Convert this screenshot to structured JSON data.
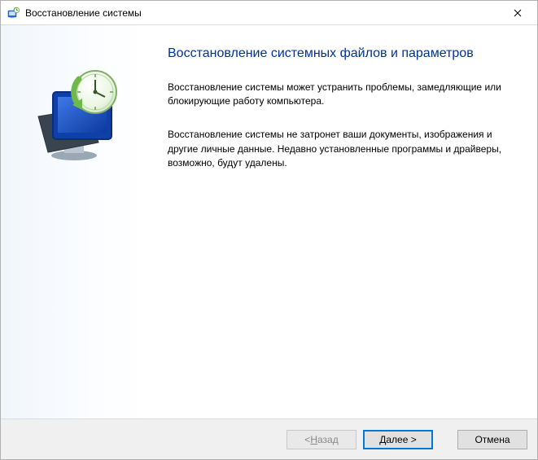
{
  "window": {
    "title": "Восстановление системы"
  },
  "content": {
    "heading": "Восстановление системных файлов и параметров",
    "para1": "Восстановление системы может устранить проблемы, замедляющие или блокирующие работу компьютера.",
    "para2": "Восстановление системы не затронет ваши документы, изображения и другие личные данные. Недавно установленные программы и драйверы, возможно, будут удалены."
  },
  "footer": {
    "back_prefix": "< ",
    "back_mn": "Н",
    "back_suffix": "азад",
    "next_mn": "Д",
    "next_suffix": "алее >",
    "cancel": "Отмена"
  },
  "icons": {
    "app": "system-restore-icon",
    "close": "close-icon",
    "graphic": "restore-graphic"
  }
}
